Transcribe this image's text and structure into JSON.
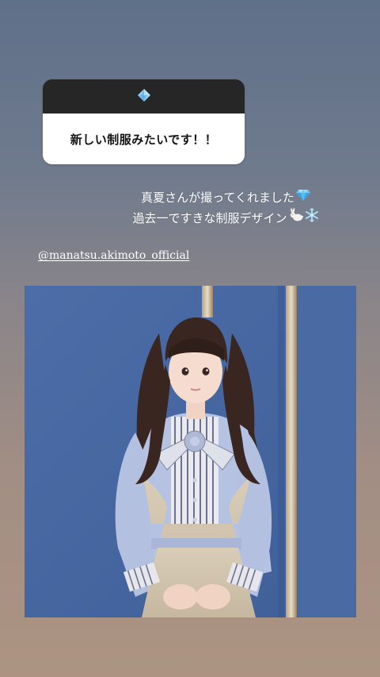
{
  "question_sticker": {
    "text": "新しい制服みたいです！！",
    "icon": "blue-diamond-icon",
    "accent": "#8ec9ee"
  },
  "caption": {
    "line1": "真夏さんが撮ってくれました",
    "line2": "過去一ですきな制服デザイン"
  },
  "emojis": {
    "line1": [
      "gem-emoji"
    ],
    "line2": [
      "rabbit-emoji",
      "snowflake-emoji"
    ]
  },
  "mention": "@manatsu.akimoto_official",
  "photo": {
    "description_icon": "portrait-photo"
  },
  "colors": {
    "background_top": "#5f7089",
    "background_bottom": "#ad9482",
    "wall_blue": "#4f6fa8"
  }
}
